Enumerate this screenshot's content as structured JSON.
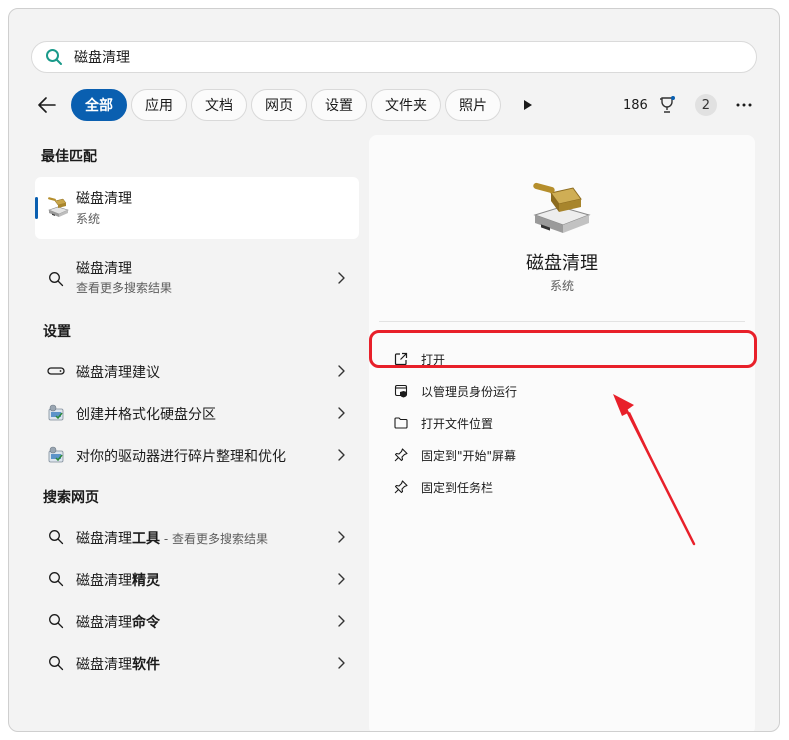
{
  "search": {
    "query": "磁盘清理"
  },
  "filters": {
    "tabs": [
      {
        "label": "全部",
        "active": true
      },
      {
        "label": "应用"
      },
      {
        "label": "文档"
      },
      {
        "label": "网页"
      },
      {
        "label": "设置"
      },
      {
        "label": "文件夹"
      },
      {
        "label": "照片"
      }
    ]
  },
  "toolbar": {
    "points": "186",
    "badge": "2"
  },
  "sections": {
    "best": "最佳匹配",
    "settings": "设置",
    "web": "搜索网页"
  },
  "best_match": {
    "title": "磁盘清理",
    "subtitle": "系统"
  },
  "more_results": {
    "title": "磁盘清理",
    "subtitle": "查看更多搜索结果"
  },
  "settings_items": [
    {
      "label": "磁盘清理建议"
    },
    {
      "label": "创建并格式化硬盘分区"
    },
    {
      "label": "对你的驱动器进行碎片整理和优化"
    }
  ],
  "web_items": [
    {
      "prefix": "磁盘清理",
      "bold": "工具",
      "hint": " - 查看更多搜索结果"
    },
    {
      "prefix": "磁盘清理",
      "bold": "精灵"
    },
    {
      "prefix": "磁盘清理",
      "bold": "命令"
    },
    {
      "prefix": "磁盘清理",
      "bold": "软件"
    }
  ],
  "preview": {
    "title": "磁盘清理",
    "subtitle": "系统",
    "actions": [
      {
        "label": "打开",
        "icon": "open-external-icon"
      },
      {
        "label": "以管理员身份运行",
        "icon": "shield-admin-icon"
      },
      {
        "label": "打开文件位置",
        "icon": "folder-icon"
      },
      {
        "label": "固定到\"开始\"屏幕",
        "icon": "pin-icon"
      },
      {
        "label": "固定到任务栏",
        "icon": "pin-icon"
      }
    ]
  },
  "colors": {
    "accent": "#0a5fb0",
    "annotation": "#e8202a"
  }
}
